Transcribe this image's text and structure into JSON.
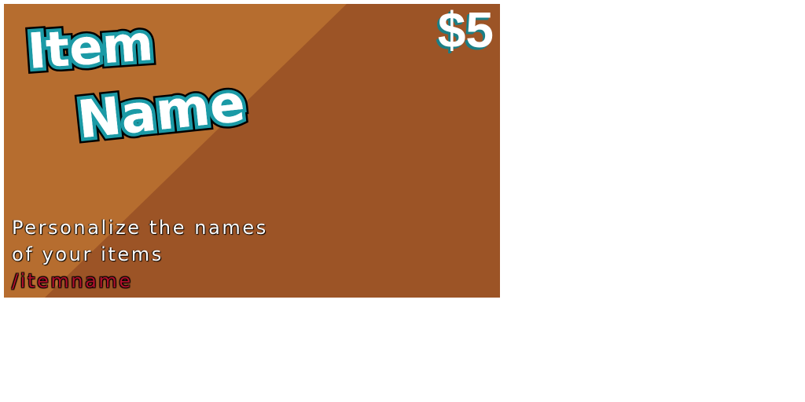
{
  "card": {
    "title_line_1": "Item",
    "title_line_2": "Name",
    "price": "$5",
    "description_line_1": "Personalize the names",
    "description_line_2": "of your items",
    "command": "/itemname",
    "colors": {
      "background_light": "#b66d2f",
      "background_dark": "#9c5426",
      "title_fill": "#ffffff",
      "title_outline": "#1b9aa6",
      "price_shadow": "#1b7f86",
      "command": "#b0102a"
    }
  }
}
